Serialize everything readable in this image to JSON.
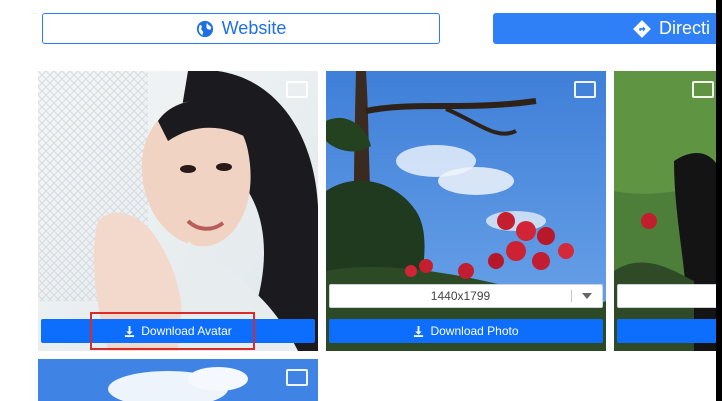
{
  "top_buttons": {
    "website_label": "Website",
    "directions_label": "Directi"
  },
  "cards": [
    {
      "download_label": "Download Avatar"
    },
    {
      "size_value": "1440x1799",
      "download_label": "Download Photo"
    }
  ],
  "colors": {
    "accent": "#0d6efd",
    "highlight": "#d92b2b"
  }
}
